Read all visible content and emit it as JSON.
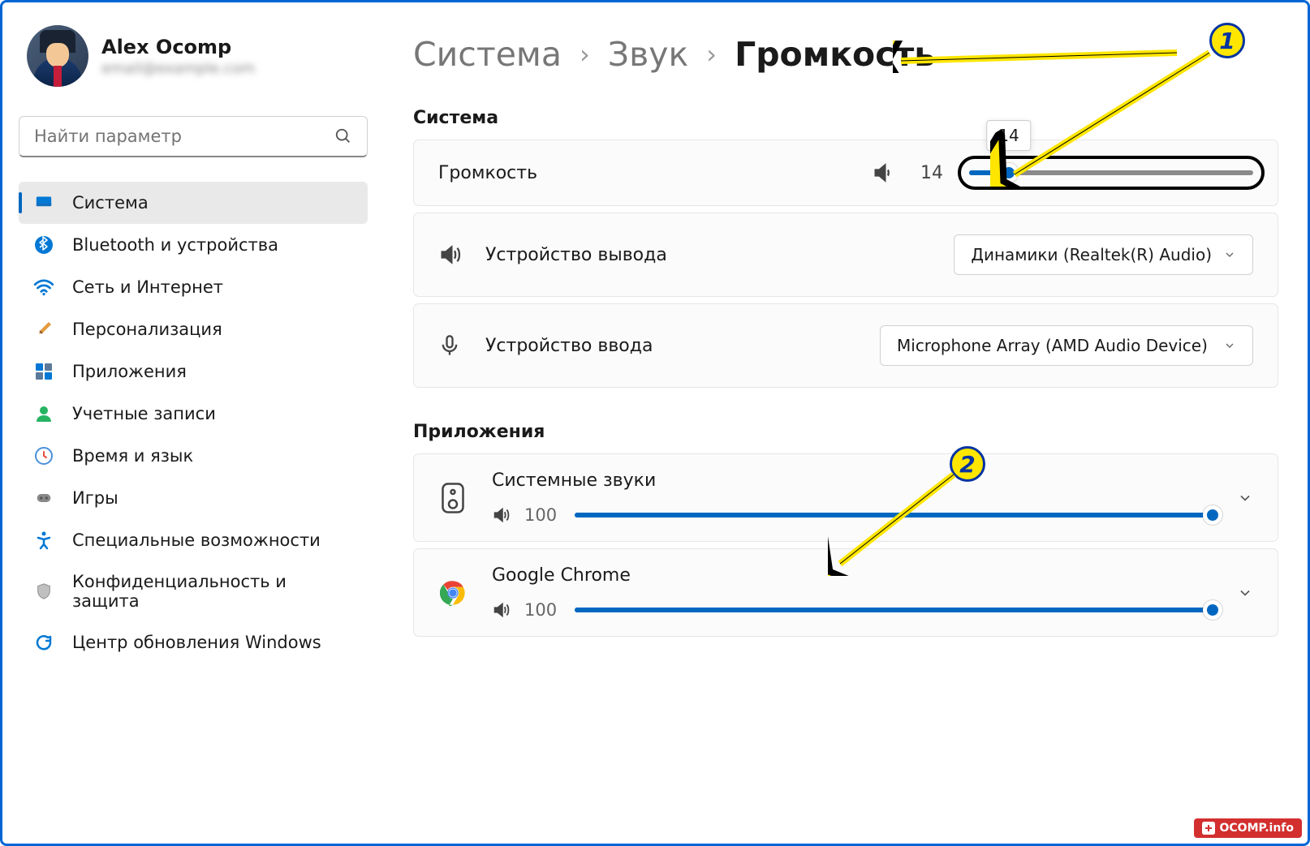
{
  "user": {
    "name": "Alex Ocomp",
    "email": "email@example.com"
  },
  "search": {
    "placeholder": "Найти параметр"
  },
  "nav": [
    {
      "label": "Система",
      "icon": "monitor",
      "active": true
    },
    {
      "label": "Bluetooth и устройства",
      "icon": "bluetooth",
      "active": false
    },
    {
      "label": "Сеть и Интернет",
      "icon": "wifi",
      "active": false
    },
    {
      "label": "Персонализация",
      "icon": "brush",
      "active": false
    },
    {
      "label": "Приложения",
      "icon": "apps",
      "active": false
    },
    {
      "label": "Учетные записи",
      "icon": "person",
      "active": false
    },
    {
      "label": "Время и язык",
      "icon": "clock",
      "active": false
    },
    {
      "label": "Игры",
      "icon": "gamepad",
      "active": false
    },
    {
      "label": "Специальные возможности",
      "icon": "accessibility",
      "active": false
    },
    {
      "label": "Конфиденциальность и защита",
      "icon": "shield",
      "active": false
    },
    {
      "label": "Центр обновления Windows",
      "icon": "update",
      "active": false
    }
  ],
  "breadcrumb": {
    "level1": "Система",
    "level2": "Звук",
    "current": "Громкость"
  },
  "sections": {
    "system": {
      "title": "Система",
      "volume": {
        "label": "Громкость",
        "value": 14,
        "tooltip": "14"
      },
      "output": {
        "label": "Устройство вывода",
        "selected": "Динамики (Realtek(R) Audio)"
      },
      "input": {
        "label": "Устройство ввода",
        "selected": "Microphone Array (AMD Audio Device)"
      }
    },
    "apps": {
      "title": "Приложения",
      "items": [
        {
          "name": "Системные звуки",
          "volume": 100,
          "icon": "speaker-device"
        },
        {
          "name": "Google Chrome",
          "volume": 100,
          "icon": "chrome"
        }
      ]
    }
  },
  "annotations": {
    "callout1": "1",
    "callout2": "2"
  },
  "watermark": "OCOMP.info"
}
